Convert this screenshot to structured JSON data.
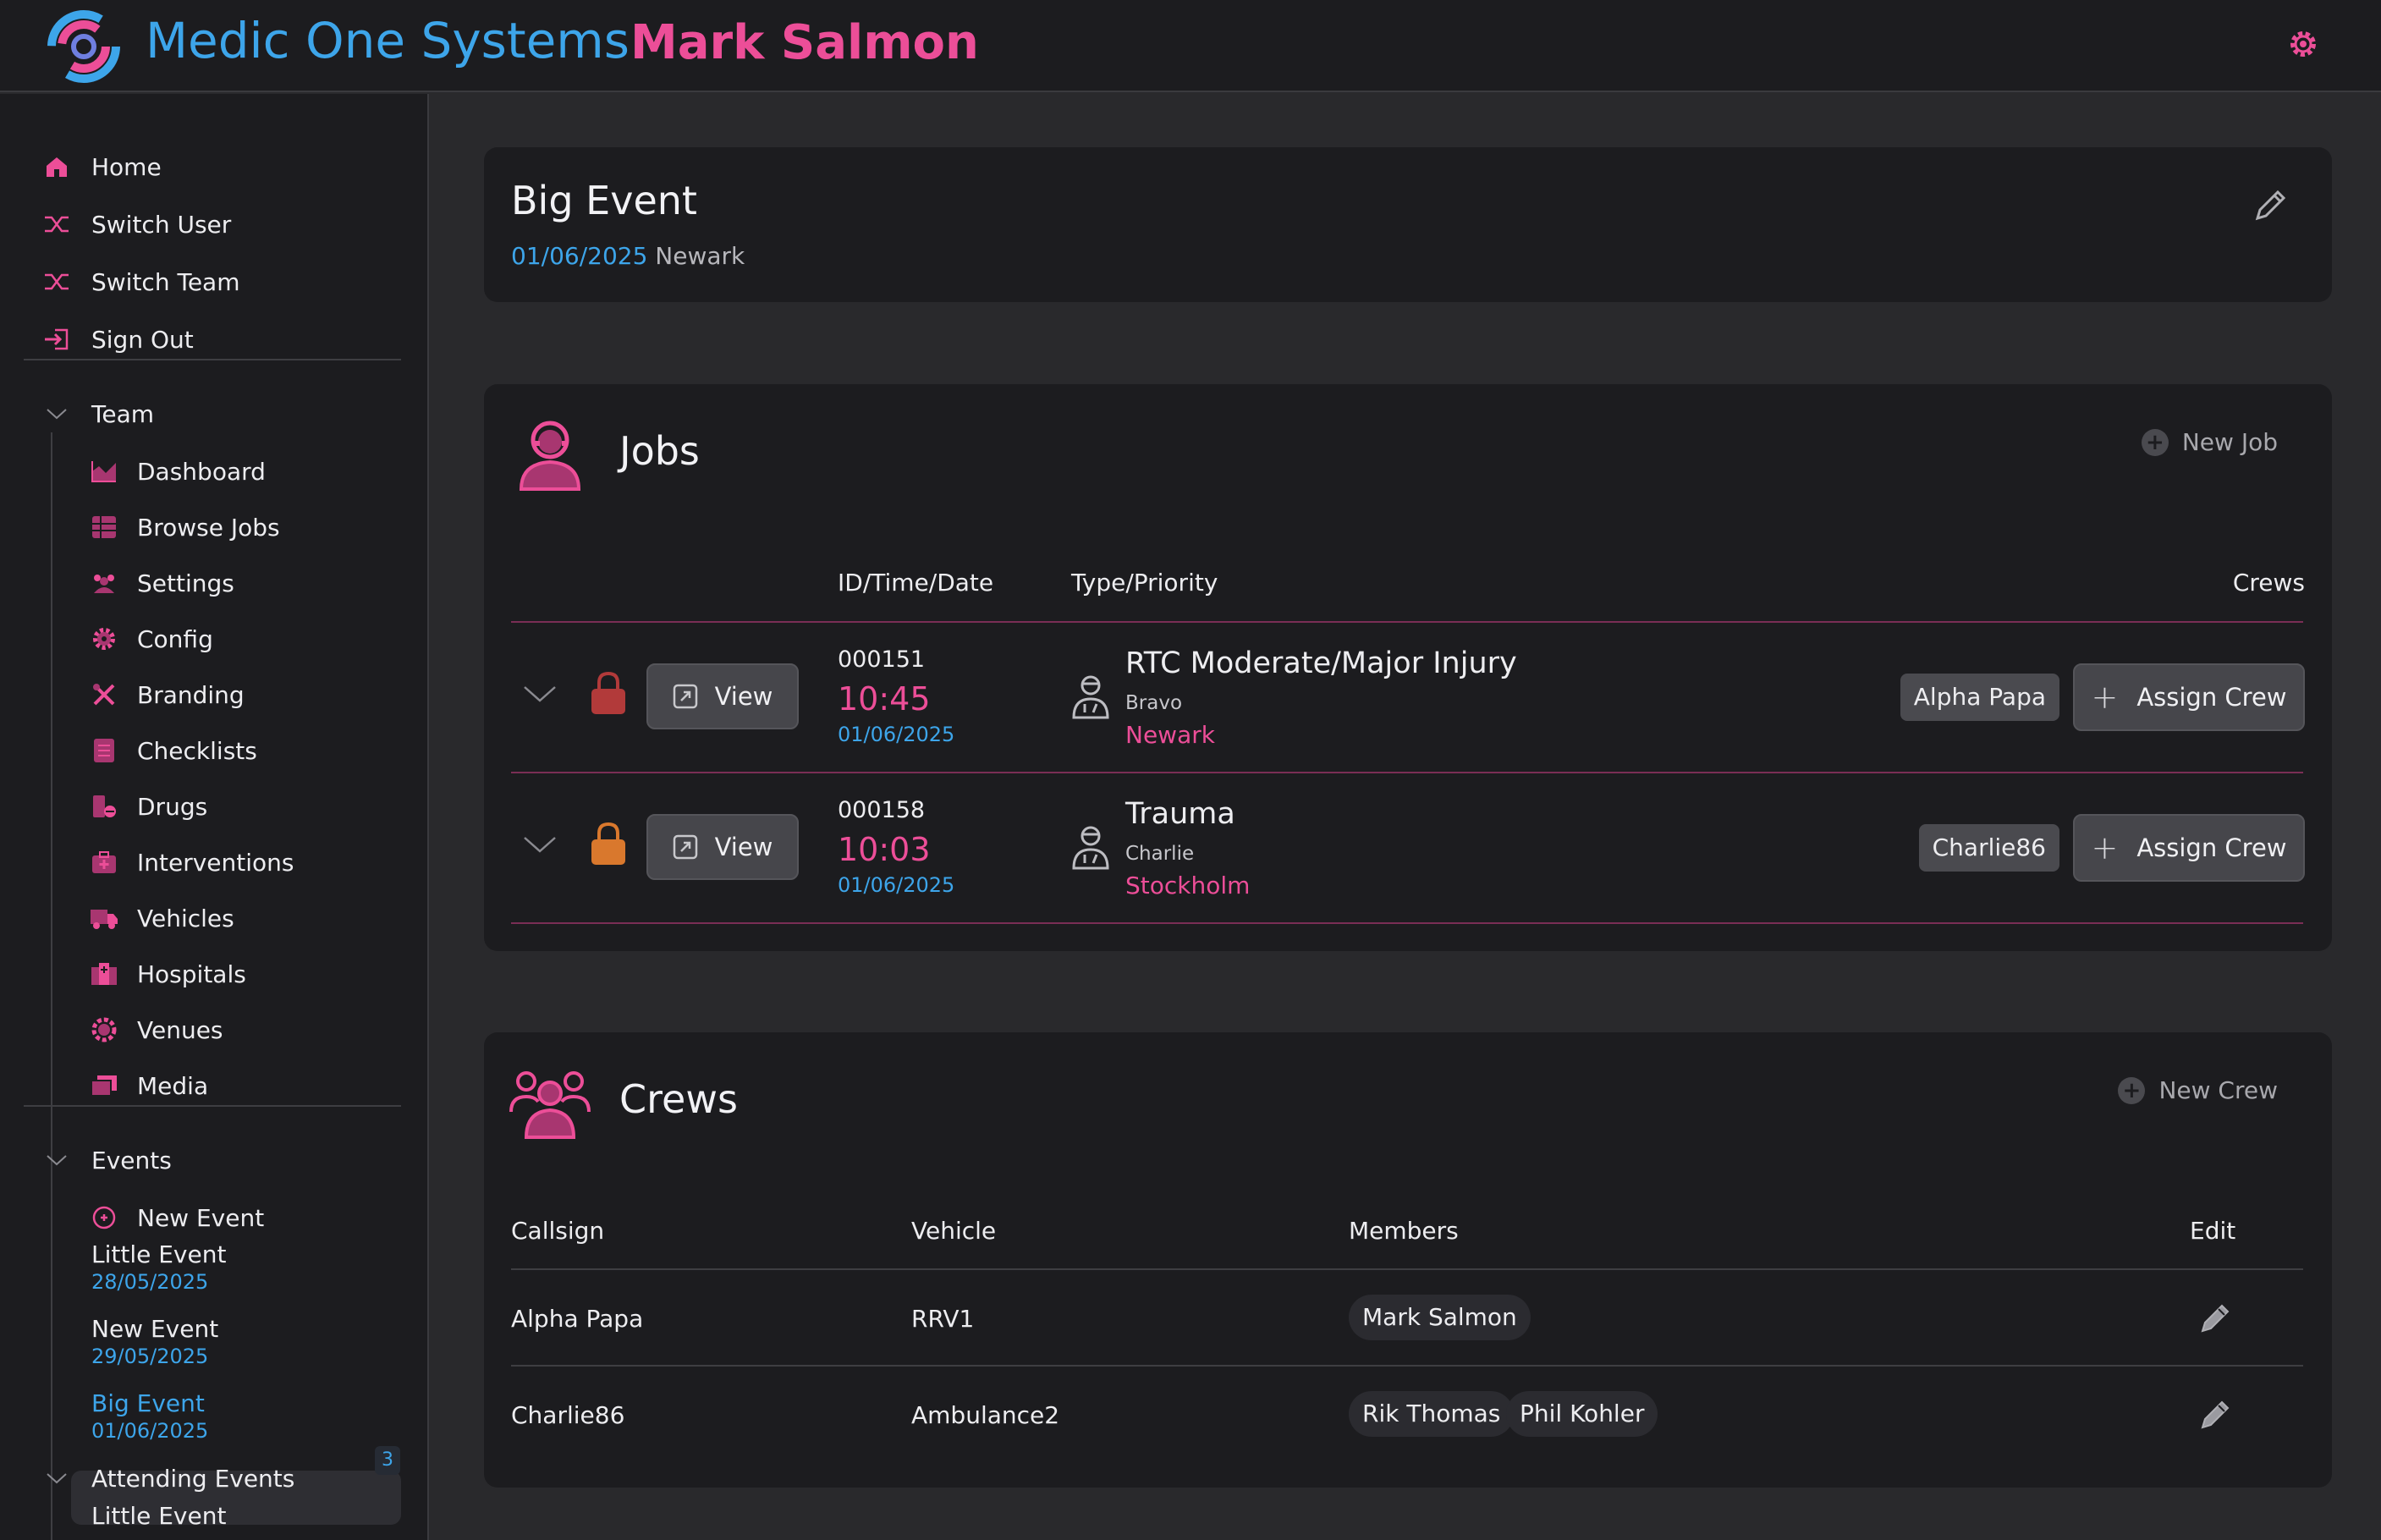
{
  "header": {
    "brand": "Medic One Systems",
    "user": "Mark Salmon"
  },
  "colors": {
    "accent_pink": "#ec4e98",
    "accent_blue": "#3da5ea",
    "background": "#29292c",
    "panel": "#1c1c1f"
  },
  "sidebar": {
    "main": [
      {
        "label": "Home",
        "icon": "home-icon"
      },
      {
        "label": "Switch User",
        "icon": "shuffle-icon"
      },
      {
        "label": "Switch Team",
        "icon": "shuffle-icon"
      },
      {
        "label": "Sign Out",
        "icon": "sign-out-icon"
      }
    ],
    "team_label": "Team",
    "team_items": [
      {
        "label": "Dashboard",
        "icon": "chart-icon"
      },
      {
        "label": "Browse Jobs",
        "icon": "table-icon"
      },
      {
        "label": "Settings",
        "icon": "people-icon"
      },
      {
        "label": "Config",
        "icon": "gear-icon"
      },
      {
        "label": "Branding",
        "icon": "tools-icon"
      },
      {
        "label": "Checklists",
        "icon": "checklist-icon"
      },
      {
        "label": "Drugs",
        "icon": "drugs-icon"
      },
      {
        "label": "Interventions",
        "icon": "medkit-icon"
      },
      {
        "label": "Vehicles",
        "icon": "ambulance-icon"
      },
      {
        "label": "Hospitals",
        "icon": "hospital-icon"
      },
      {
        "label": "Venues",
        "icon": "venue-icon"
      },
      {
        "label": "Media",
        "icon": "media-icon"
      }
    ],
    "events_label": "Events",
    "new_event": "New Event",
    "events": [
      {
        "title": "Little Event",
        "date": "28/05/2025"
      },
      {
        "title": "New Event",
        "date": "29/05/2025"
      },
      {
        "title": "Big Event",
        "date": "01/06/2025"
      }
    ],
    "attending_label": "Attending Events",
    "attending_count": "3",
    "attending_first": "Little Event"
  },
  "event": {
    "title": "Big Event",
    "date": "01/06/2025",
    "location": "Newark"
  },
  "jobs": {
    "title": "Jobs",
    "new_label": "New Job",
    "headers": {
      "id": "ID/Time/Date",
      "type": "Type/Priority",
      "crews": "Crews"
    },
    "rows": [
      {
        "id": "000151",
        "time": "10:45",
        "date": "01/06/2025",
        "type": "RTC Moderate/Major Injury",
        "priority": "Bravo",
        "location": "Newark",
        "crew": "Alpha Papa",
        "view": "View",
        "assign": "Assign Crew",
        "lock_color": "#b23a3a"
      },
      {
        "id": "000158",
        "time": "10:03",
        "date": "01/06/2025",
        "type": "Trauma",
        "priority": "Charlie",
        "location": "Stockholm",
        "crew": "Charlie86",
        "view": "View",
        "assign": "Assign Crew",
        "lock_color": "#d9782d"
      }
    ]
  },
  "crews": {
    "title": "Crews",
    "new_label": "New Crew",
    "headers": {
      "callsign": "Callsign",
      "vehicle": "Vehicle",
      "members": "Members",
      "edit": "Edit"
    },
    "rows": [
      {
        "callsign": "Alpha Papa",
        "vehicle": "RRV1",
        "members": [
          "Mark Salmon"
        ]
      },
      {
        "callsign": "Charlie86",
        "vehicle": "Ambulance2",
        "members": [
          "Rik Thomas",
          "Phil Kohler"
        ]
      }
    ]
  }
}
